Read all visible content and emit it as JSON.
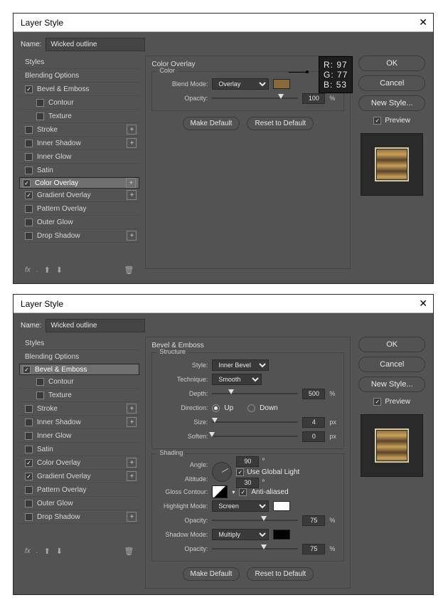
{
  "dialogs": [
    {
      "title": "Layer Style",
      "name_label": "Name:",
      "name_value": "Wicked outline",
      "styles_header": "Styles",
      "blending_options": "Blending Options",
      "effects": [
        {
          "label": "Bevel & Emboss",
          "checked": true,
          "plus": false,
          "selected": false
        },
        {
          "label": "Contour",
          "indent": true,
          "checked": false,
          "plus": false
        },
        {
          "label": "Texture",
          "indent": true,
          "checked": false,
          "plus": false
        },
        {
          "label": "Stroke",
          "checked": false,
          "plus": true
        },
        {
          "label": "Inner Shadow",
          "checked": false,
          "plus": true
        },
        {
          "label": "Inner Glow",
          "checked": false,
          "plus": false
        },
        {
          "label": "Satin",
          "checked": false,
          "plus": false
        },
        {
          "label": "Color Overlay",
          "checked": true,
          "plus": true,
          "selected": true
        },
        {
          "label": "Gradient Overlay",
          "checked": true,
          "plus": true
        },
        {
          "label": "Pattern Overlay",
          "checked": false,
          "plus": false
        },
        {
          "label": "Outer Glow",
          "checked": false,
          "plus": false
        },
        {
          "label": "Drop Shadow",
          "checked": false,
          "plus": true
        }
      ],
      "fx_label": "fx",
      "panel_title": "Color Overlay",
      "group_label": "Color",
      "blend_mode_label": "Blend Mode:",
      "blend_mode_value": "Overlay",
      "opacity_label": "Opacity:",
      "opacity_value": "100",
      "opacity_pct": 80,
      "opacity_unit": "%",
      "color_swatch": "#8a6a3a",
      "make_default": "Make Default",
      "reset_default": "Reset to Default",
      "rgb": {
        "r": "R: 97",
        "g": "G: 77",
        "b": "B: 53"
      },
      "ok": "OK",
      "cancel": "Cancel",
      "new_style": "New Style...",
      "preview": "Preview"
    },
    {
      "title": "Layer Style",
      "name_label": "Name:",
      "name_value": "Wicked outline",
      "styles_header": "Styles",
      "blending_options": "Blending Options",
      "effects": [
        {
          "label": "Bevel & Emboss",
          "checked": true,
          "plus": false,
          "selected": true
        },
        {
          "label": "Contour",
          "indent": true,
          "checked": false,
          "plus": false
        },
        {
          "label": "Texture",
          "indent": true,
          "checked": false,
          "plus": false
        },
        {
          "label": "Stroke",
          "checked": false,
          "plus": true
        },
        {
          "label": "Inner Shadow",
          "checked": false,
          "plus": true
        },
        {
          "label": "Inner Glow",
          "checked": false,
          "plus": false
        },
        {
          "label": "Satin",
          "checked": false,
          "plus": false
        },
        {
          "label": "Color Overlay",
          "checked": true,
          "plus": true
        },
        {
          "label": "Gradient Overlay",
          "checked": true,
          "plus": true
        },
        {
          "label": "Pattern Overlay",
          "checked": false,
          "plus": false
        },
        {
          "label": "Outer Glow",
          "checked": false,
          "plus": false
        },
        {
          "label": "Drop Shadow",
          "checked": false,
          "plus": true
        }
      ],
      "fx_label": "fx",
      "panel_title": "Bevel & Emboss",
      "structure": {
        "label": "Structure",
        "style_label": "Style:",
        "style_value": "Inner Bevel",
        "technique_label": "Technique:",
        "technique_value": "Smooth",
        "depth_label": "Depth:",
        "depth_value": "500",
        "depth_pct": 22,
        "depth_unit": "%",
        "direction_label": "Direction:",
        "up": "Up",
        "down": "Down",
        "dir": "up",
        "size_label": "Size:",
        "size_value": "4",
        "size_pct": 3,
        "size_unit": "px",
        "soften_label": "Soften:",
        "soften_value": "0",
        "soften_pct": 0,
        "soften_unit": "px"
      },
      "shading": {
        "label": "Shading",
        "angle_label": "Angle:",
        "angle_value": "90",
        "deg": "°",
        "use_global": "Use Global Light",
        "use_global_checked": true,
        "altitude_label": "Altitude:",
        "altitude_value": "30",
        "gloss_label": "Gloss Contour:",
        "anti": "Anti-aliased",
        "anti_checked": true,
        "hmode_label": "Highlight Mode:",
        "hmode_value": "Screen",
        "hcolor": "#ffffff",
        "hopacity": "75",
        "hop_pct": 60,
        "smode_label": "Shadow Mode:",
        "smode_value": "Multiply",
        "scolor": "#000000",
        "sopacity": "75",
        "sop_pct": 60,
        "opacity_label": "Opacity:",
        "unit": "%"
      },
      "make_default": "Make Default",
      "reset_default": "Reset to Default",
      "ok": "OK",
      "cancel": "Cancel",
      "new_style": "New Style...",
      "preview": "Preview"
    }
  ]
}
